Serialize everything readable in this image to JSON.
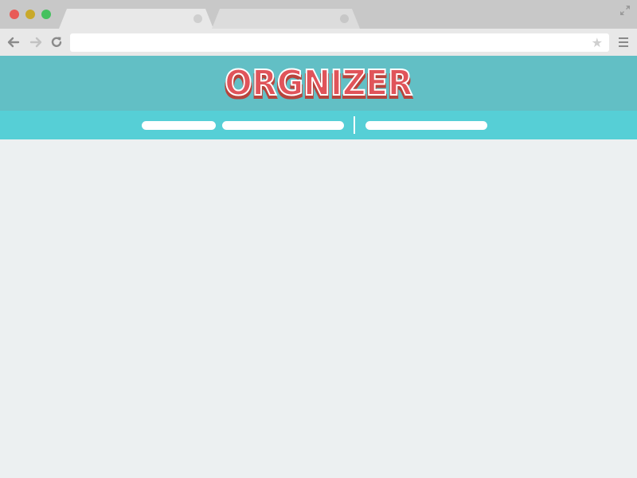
{
  "window": {
    "traffic_lights": [
      "close",
      "minimize",
      "maximize"
    ],
    "tabs": [
      {
        "label": "",
        "active": true
      },
      {
        "label": "",
        "active": false
      }
    ]
  },
  "toolbar": {
    "url": "",
    "icons": [
      "back-arrow-icon",
      "forward-arrow-icon",
      "reload-icon",
      "star-icon",
      "menu-icon",
      "fullscreen-icon"
    ]
  },
  "site": {
    "logo_text": "ORGNIZER",
    "nav_items": [
      "",
      "",
      ""
    ],
    "colors": {
      "header_bg": "#62bfc5",
      "nav_bg": "#56cfd6",
      "logo_fill": "#e0545a",
      "logo_shadow": "#b8443c",
      "content_bg": "#ecf0f1"
    }
  }
}
